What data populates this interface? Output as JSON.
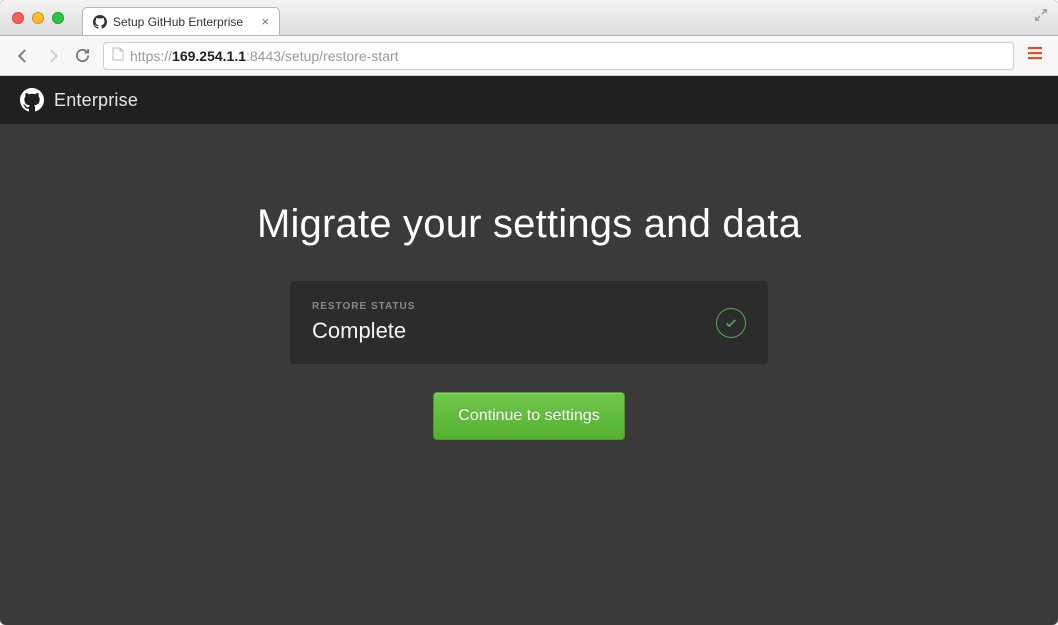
{
  "browser": {
    "tab_title": "Setup GitHub Enterprise",
    "url": {
      "protocol": "https://",
      "host": "169.254.1.1",
      "port": ":8443",
      "path": "/setup/restore-start"
    }
  },
  "header": {
    "brand": "Enterprise"
  },
  "main": {
    "title": "Migrate your settings and data",
    "status": {
      "label": "RESTORE STATUS",
      "value": "Complete"
    },
    "cta_label": "Continue to settings"
  }
}
